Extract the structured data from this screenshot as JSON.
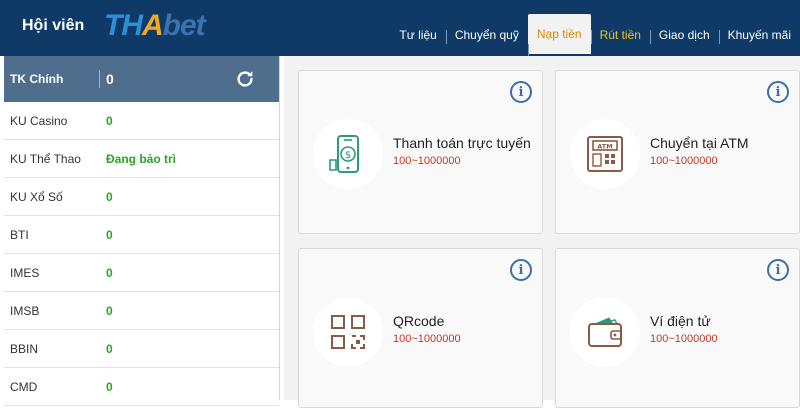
{
  "header": {
    "member_label": "Hội viên",
    "logo": {
      "part1": "TH",
      "part2": "A",
      "part3": "bet"
    },
    "nav": [
      {
        "label": "Tư liệu"
      },
      {
        "label": "Chuyển quỹ"
      },
      {
        "label": "Nạp tiền"
      },
      {
        "label": "Rút tiền"
      },
      {
        "label": "Giao dịch"
      },
      {
        "label": "Khuyến mãi"
      }
    ]
  },
  "sidebar": {
    "main_account": {
      "label": "TK Chính",
      "value": "0"
    },
    "accounts": [
      {
        "label": "KU Casino",
        "value": "0"
      },
      {
        "label": "KU Thể Thao",
        "value": "Đang bảo trì"
      },
      {
        "label": "KU Xổ Số",
        "value": "0"
      },
      {
        "label": "BTI",
        "value": "0"
      },
      {
        "label": "IMES",
        "value": "0"
      },
      {
        "label": "IMSB",
        "value": "0"
      },
      {
        "label": "BBIN",
        "value": "0"
      },
      {
        "label": "CMD",
        "value": "0"
      }
    ]
  },
  "methods": [
    {
      "title": "Thanh toán trực tuyến",
      "range": "100~1000000",
      "icon": "mobile-payment-icon"
    },
    {
      "title": "Chuyển tại ATM",
      "range": "100~1000000",
      "icon": "atm-icon"
    },
    {
      "title": "QRcode",
      "range": "100~1000000",
      "icon": "qrcode-icon"
    },
    {
      "title": "Ví điện tử",
      "range": "100~1000000",
      "icon": "wallet-icon"
    }
  ],
  "colors": {
    "header_bg": "#0f3a67",
    "active_tab_text": "#d98a00",
    "highlight_tab_text": "#f5c518",
    "balance_green": "#2aa52a",
    "range_red": "#c0392b",
    "icon_teal": "#2e9a7a",
    "icon_brown": "#8a5a44"
  }
}
